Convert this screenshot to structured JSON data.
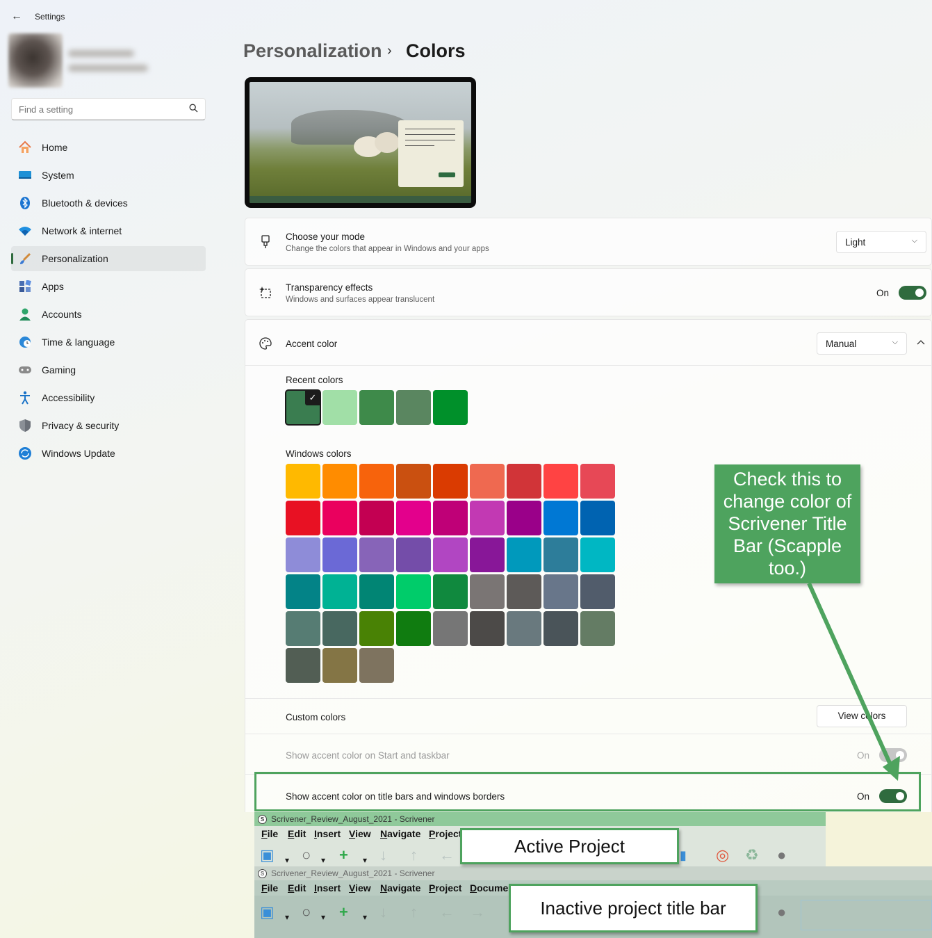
{
  "window": {
    "back_glyph": "←",
    "title": "Settings"
  },
  "search": {
    "placeholder": "Find a setting"
  },
  "sidebar": {
    "items": [
      {
        "label": "Home",
        "icon": "home-icon"
      },
      {
        "label": "System",
        "icon": "system-icon"
      },
      {
        "label": "Bluetooth & devices",
        "icon": "bluetooth-icon"
      },
      {
        "label": "Network & internet",
        "icon": "wifi-icon"
      },
      {
        "label": "Personalization",
        "icon": "brush-icon",
        "active": true
      },
      {
        "label": "Apps",
        "icon": "apps-icon"
      },
      {
        "label": "Accounts",
        "icon": "account-icon"
      },
      {
        "label": "Time & language",
        "icon": "clock-globe-icon"
      },
      {
        "label": "Gaming",
        "icon": "gamepad-icon"
      },
      {
        "label": "Accessibility",
        "icon": "accessibility-icon"
      },
      {
        "label": "Privacy & security",
        "icon": "shield-icon"
      },
      {
        "label": "Windows Update",
        "icon": "update-icon"
      }
    ]
  },
  "header": {
    "breadcrumb": "Personalization",
    "separator": "›",
    "title": "Colors"
  },
  "mode": {
    "title": "Choose your mode",
    "subtitle": "Change the colors that appear in Windows and your apps",
    "value": "Light"
  },
  "transparency": {
    "title": "Transparency effects",
    "subtitle": "Windows and surfaces appear translucent",
    "state": "On"
  },
  "accent": {
    "title": "Accent color",
    "value": "Manual",
    "recent_label": "Recent colors",
    "recent_colors": [
      "#3a7d50",
      "#a1dfa7",
      "#3e8a4a",
      "#5a8660",
      "#00902a"
    ],
    "windows_label": "Windows colors",
    "windows_colors": [
      [
        "#ffb900",
        "#ff8c00",
        "#f7630c",
        "#ca5010",
        "#da3b01",
        "#ef6950",
        "#d13438",
        "#ff4343",
        "#e74856"
      ],
      [
        "#e81123",
        "#ea005e",
        "#c30052",
        "#e3008c",
        "#bf0077",
        "#c239b3",
        "#9a0089",
        "#0078d4",
        "#0063b1"
      ],
      [
        "#8e8cd8",
        "#6b69d6",
        "#8764b8",
        "#744da9",
        "#b146c2",
        "#881798",
        "#0099bc",
        "#2d7d9a",
        "#00b7c3"
      ],
      [
        "#038387",
        "#00b294",
        "#018574",
        "#00cc6a",
        "#10893e",
        "#7a7574",
        "#5d5a58",
        "#68768a",
        "#515c6b"
      ],
      [
        "#567c73",
        "#486860",
        "#498205",
        "#107c10",
        "#767676",
        "#4c4a48",
        "#69797e",
        "#4a5459",
        "#647c64"
      ],
      [
        "#525e54",
        "#847545",
        "#7e735f"
      ]
    ],
    "custom_label": "Custom colors",
    "view_colors_label": "View colors",
    "start_taskbar_label": "Show accent color on Start and taskbar",
    "start_taskbar_state": "On",
    "title_bars_label": "Show accent color on title bars and windows borders",
    "title_bars_state": "On"
  },
  "annotations": {
    "note": "Check this to change color of Scrivener Title Bar (Scapple too.)",
    "active": "Active Project",
    "inactive": "Inactive project title bar",
    "color": "#4ea35e"
  },
  "scrivener": {
    "logo": "S",
    "active_title": "Scrivener_Review_August_2021 - Scrivener",
    "inactive_title": "Scrivener_Review_August_2021 - Scrivener",
    "active_menu": [
      "File",
      "Edit",
      "Insert",
      "View",
      "Navigate",
      "Project"
    ],
    "inactive_menu": [
      "File",
      "Edit",
      "Insert",
      "View",
      "Navigate",
      "Project",
      "Document"
    ],
    "active_titlebar_color": "#8fc99a",
    "inactive_titlebar_color": "#c9d3cb"
  }
}
